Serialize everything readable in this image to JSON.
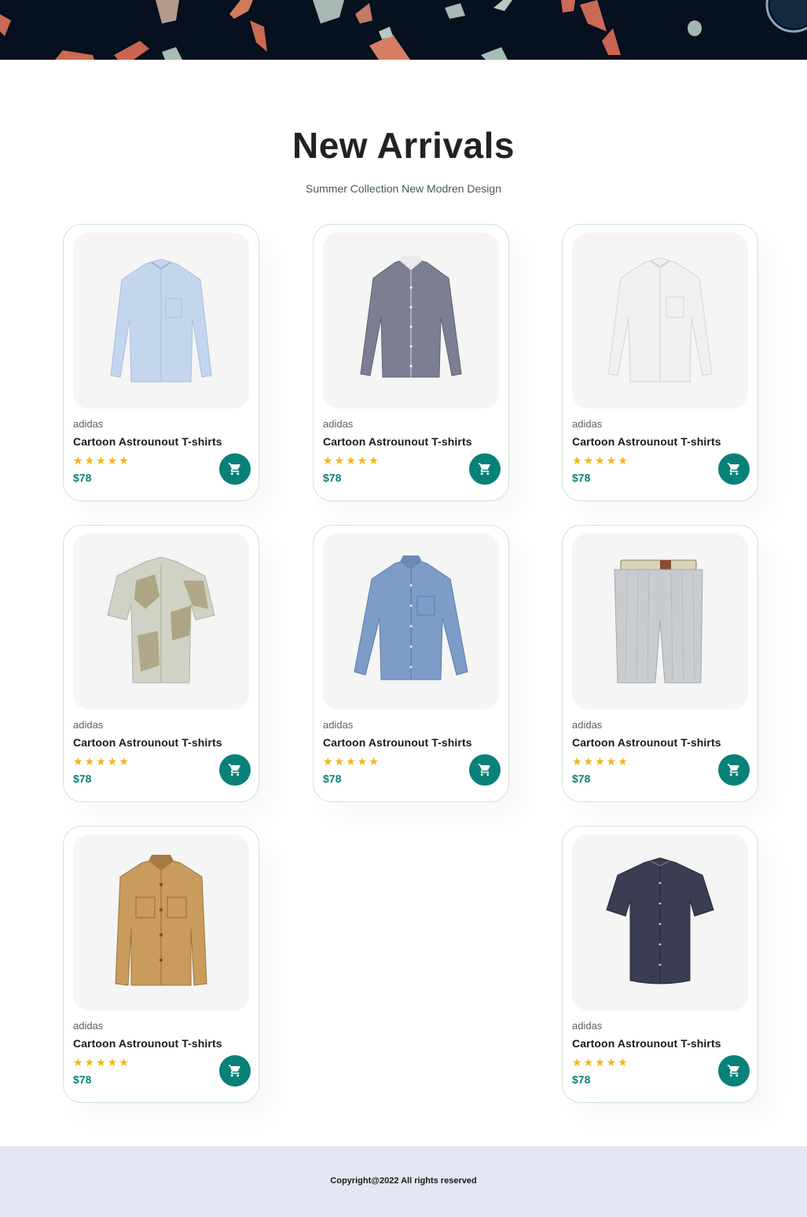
{
  "section": {
    "title": "New Arrivals",
    "subtitle": "Summer Collection New Modren Design"
  },
  "colors": {
    "accent": "#088178",
    "star": "#f3b516",
    "card_border": "#cce7d0",
    "footer_bg": "#e3e6f3",
    "banner_bg": "#06101e"
  },
  "products": [
    {
      "brand": "adidas",
      "name": "Cartoon Astrounout T-shirts",
      "rating": 5,
      "stars": "★★★★★",
      "price": "$78",
      "image_icon": "light-blue-shirt-image"
    },
    {
      "brand": "adidas",
      "name": "Cartoon Astrounout T-shirts",
      "rating": 5,
      "stars": "★★★★★",
      "price": "$78",
      "image_icon": "gray-check-shirt-image"
    },
    {
      "brand": "adidas",
      "name": "Cartoon Astrounout T-shirts",
      "rating": 5,
      "stars": "★★★★★",
      "price": "$78",
      "image_icon": "white-shirt-image"
    },
    {
      "brand": "adidas",
      "name": "Cartoon Astrounout T-shirts",
      "rating": 5,
      "stars": "★★★★★",
      "price": "$78",
      "image_icon": "printed-short-sleeve-shirt-image"
    },
    {
      "brand": "adidas",
      "name": "Cartoon Astrounout T-shirts",
      "rating": 5,
      "stars": "★★★★★",
      "price": "$78",
      "image_icon": "denim-shirt-image"
    },
    {
      "brand": "adidas",
      "name": "Cartoon Astrounout T-shirts",
      "rating": 5,
      "stars": "★★★★★",
      "price": "$78",
      "image_icon": "striped-shorts-image"
    },
    {
      "brand": "adidas",
      "name": "Cartoon Astrounout T-shirts",
      "rating": 5,
      "stars": "★★★★★",
      "price": "$78",
      "image_icon": "tan-overshirt-image"
    },
    {
      "brand": "adidas",
      "name": "Cartoon Astrounout T-shirts",
      "rating": 5,
      "stars": "★★★★★",
      "price": "$78",
      "image_icon": "navy-short-sleeve-shirt-image"
    }
  ],
  "cart_icon": "cart-icon",
  "footer": {
    "copyright": "Copyright@2022 All rights reserved"
  }
}
